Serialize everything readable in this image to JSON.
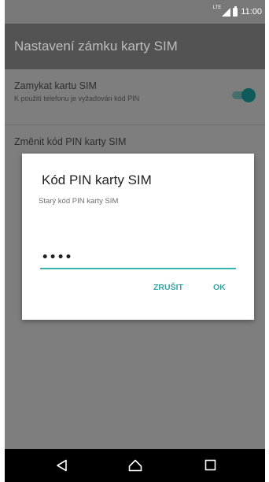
{
  "status_bar": {
    "network": "LTE",
    "time": "11:00"
  },
  "app_bar": {
    "title": "Nastavení zámku karty SIM"
  },
  "settings": {
    "lock_sim": {
      "title": "Zamykat kartu SIM",
      "subtitle": "K použití telefonu je vyžadován kód PIN",
      "enabled": true
    },
    "change_pin": {
      "title": "Změnit kód PIN karty SIM"
    }
  },
  "dialog": {
    "title": "Kód PIN karty SIM",
    "field_label": "Starý kód PIN karty SIM",
    "pin_value": "••••",
    "cancel_label": "ZRUŠIT",
    "ok_label": "OK"
  },
  "colors": {
    "accent": "#37b5b5",
    "toggle_thumb": "#0f5a5a",
    "app_bar": "#535353",
    "scrim_content": "#7e7e7e"
  },
  "nav_bar": {
    "icons": [
      "back-icon",
      "home-icon",
      "recents-icon"
    ]
  }
}
